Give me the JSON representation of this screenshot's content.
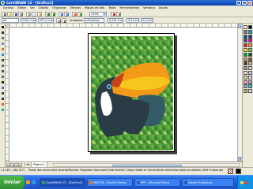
{
  "window": {
    "title": "CorelDRAW 12 - [Gráfico1]",
    "buttons": {
      "minimize": "_",
      "maximize": "□",
      "close": "×"
    }
  },
  "menubar": {
    "items": [
      "Archivo",
      "Editar",
      "Ver",
      "Diseño",
      "Organizar",
      "Efectos",
      "Mapas de bits",
      "Texto",
      "Herramientas",
      "Ventana",
      "Ayuda"
    ]
  },
  "toolbar": {
    "zoom_value": "110%",
    "zoom_arrow": "▾",
    "unit_label": "Unidades:",
    "unit_value": "milímetros",
    "nudge_value": "0,254 mm",
    "size_w": "5,0 mm",
    "size_h": "5,0 mm",
    "page_size": "A4",
    "page_w": "210,0 mm",
    "page_h": "297,0 mm"
  },
  "scrollbar": {
    "up": "▲",
    "down": "▼"
  },
  "pagebar": {
    "first": "|◂",
    "prev": "◂",
    "next": "▸",
    "last": "▸|",
    "page_count": "1 de 1",
    "page_tab": "Página 1"
  },
  "statusbar": {
    "coords": "(-5,161 ; 160,157)",
    "message": "Pulsar dos veces para recortar/Escalar; Segundo clique para Girar/Inclinar; Clique doble en herramienta selecciona todos os objetos; Shift+clique para multiselección; Alt+clique para dig..."
  },
  "taskbar": {
    "start_label": "iniciar",
    "tasks": [
      "CorelDRAW 12 - [Gráfico1]",
      "PAPOTA - Mozilla Firefox",
      "RPF - Microsoft Word",
      "Adobe Photoshop"
    ]
  },
  "palette": {
    "colors": [
      "#ffffff",
      "#000000",
      "#7f7f7f",
      "#00a0e3",
      "#0055a5",
      "#2e3192",
      "#662d91",
      "#ec008c",
      "#ed1c24",
      "#f7941d",
      "#fff200",
      "#8dc63f",
      "#00a651",
      "#005e20",
      "#c69c6d",
      "#8b5a2b",
      "#603913",
      "#c2b49a",
      "#9e9e9e",
      "#d7d7d7",
      "#fde6cf",
      "#b2d6f2",
      "#cce5a8",
      "#ffd3e0",
      "#f5a3c0",
      "#b19cd9",
      "#7fb2e5",
      "#3fbfbf",
      "#a6ce39",
      "#e0e0e0"
    ]
  },
  "artwork": {
    "colors": {
      "leaf_light": "#a8d468",
      "leaf_mid": "#6db23a",
      "leaf_dark": "#2e7d32",
      "pattern_bg": "#4f9a3c",
      "beak_orange": "#f39a18",
      "beak_yellow": "#f7c61e",
      "beak_red": "#c9411a",
      "bird_black": "#2a3c45",
      "bird_teal": "#355c66",
      "throat_white": "#ffffff",
      "eye_blue": "#6cb4e0"
    }
  }
}
